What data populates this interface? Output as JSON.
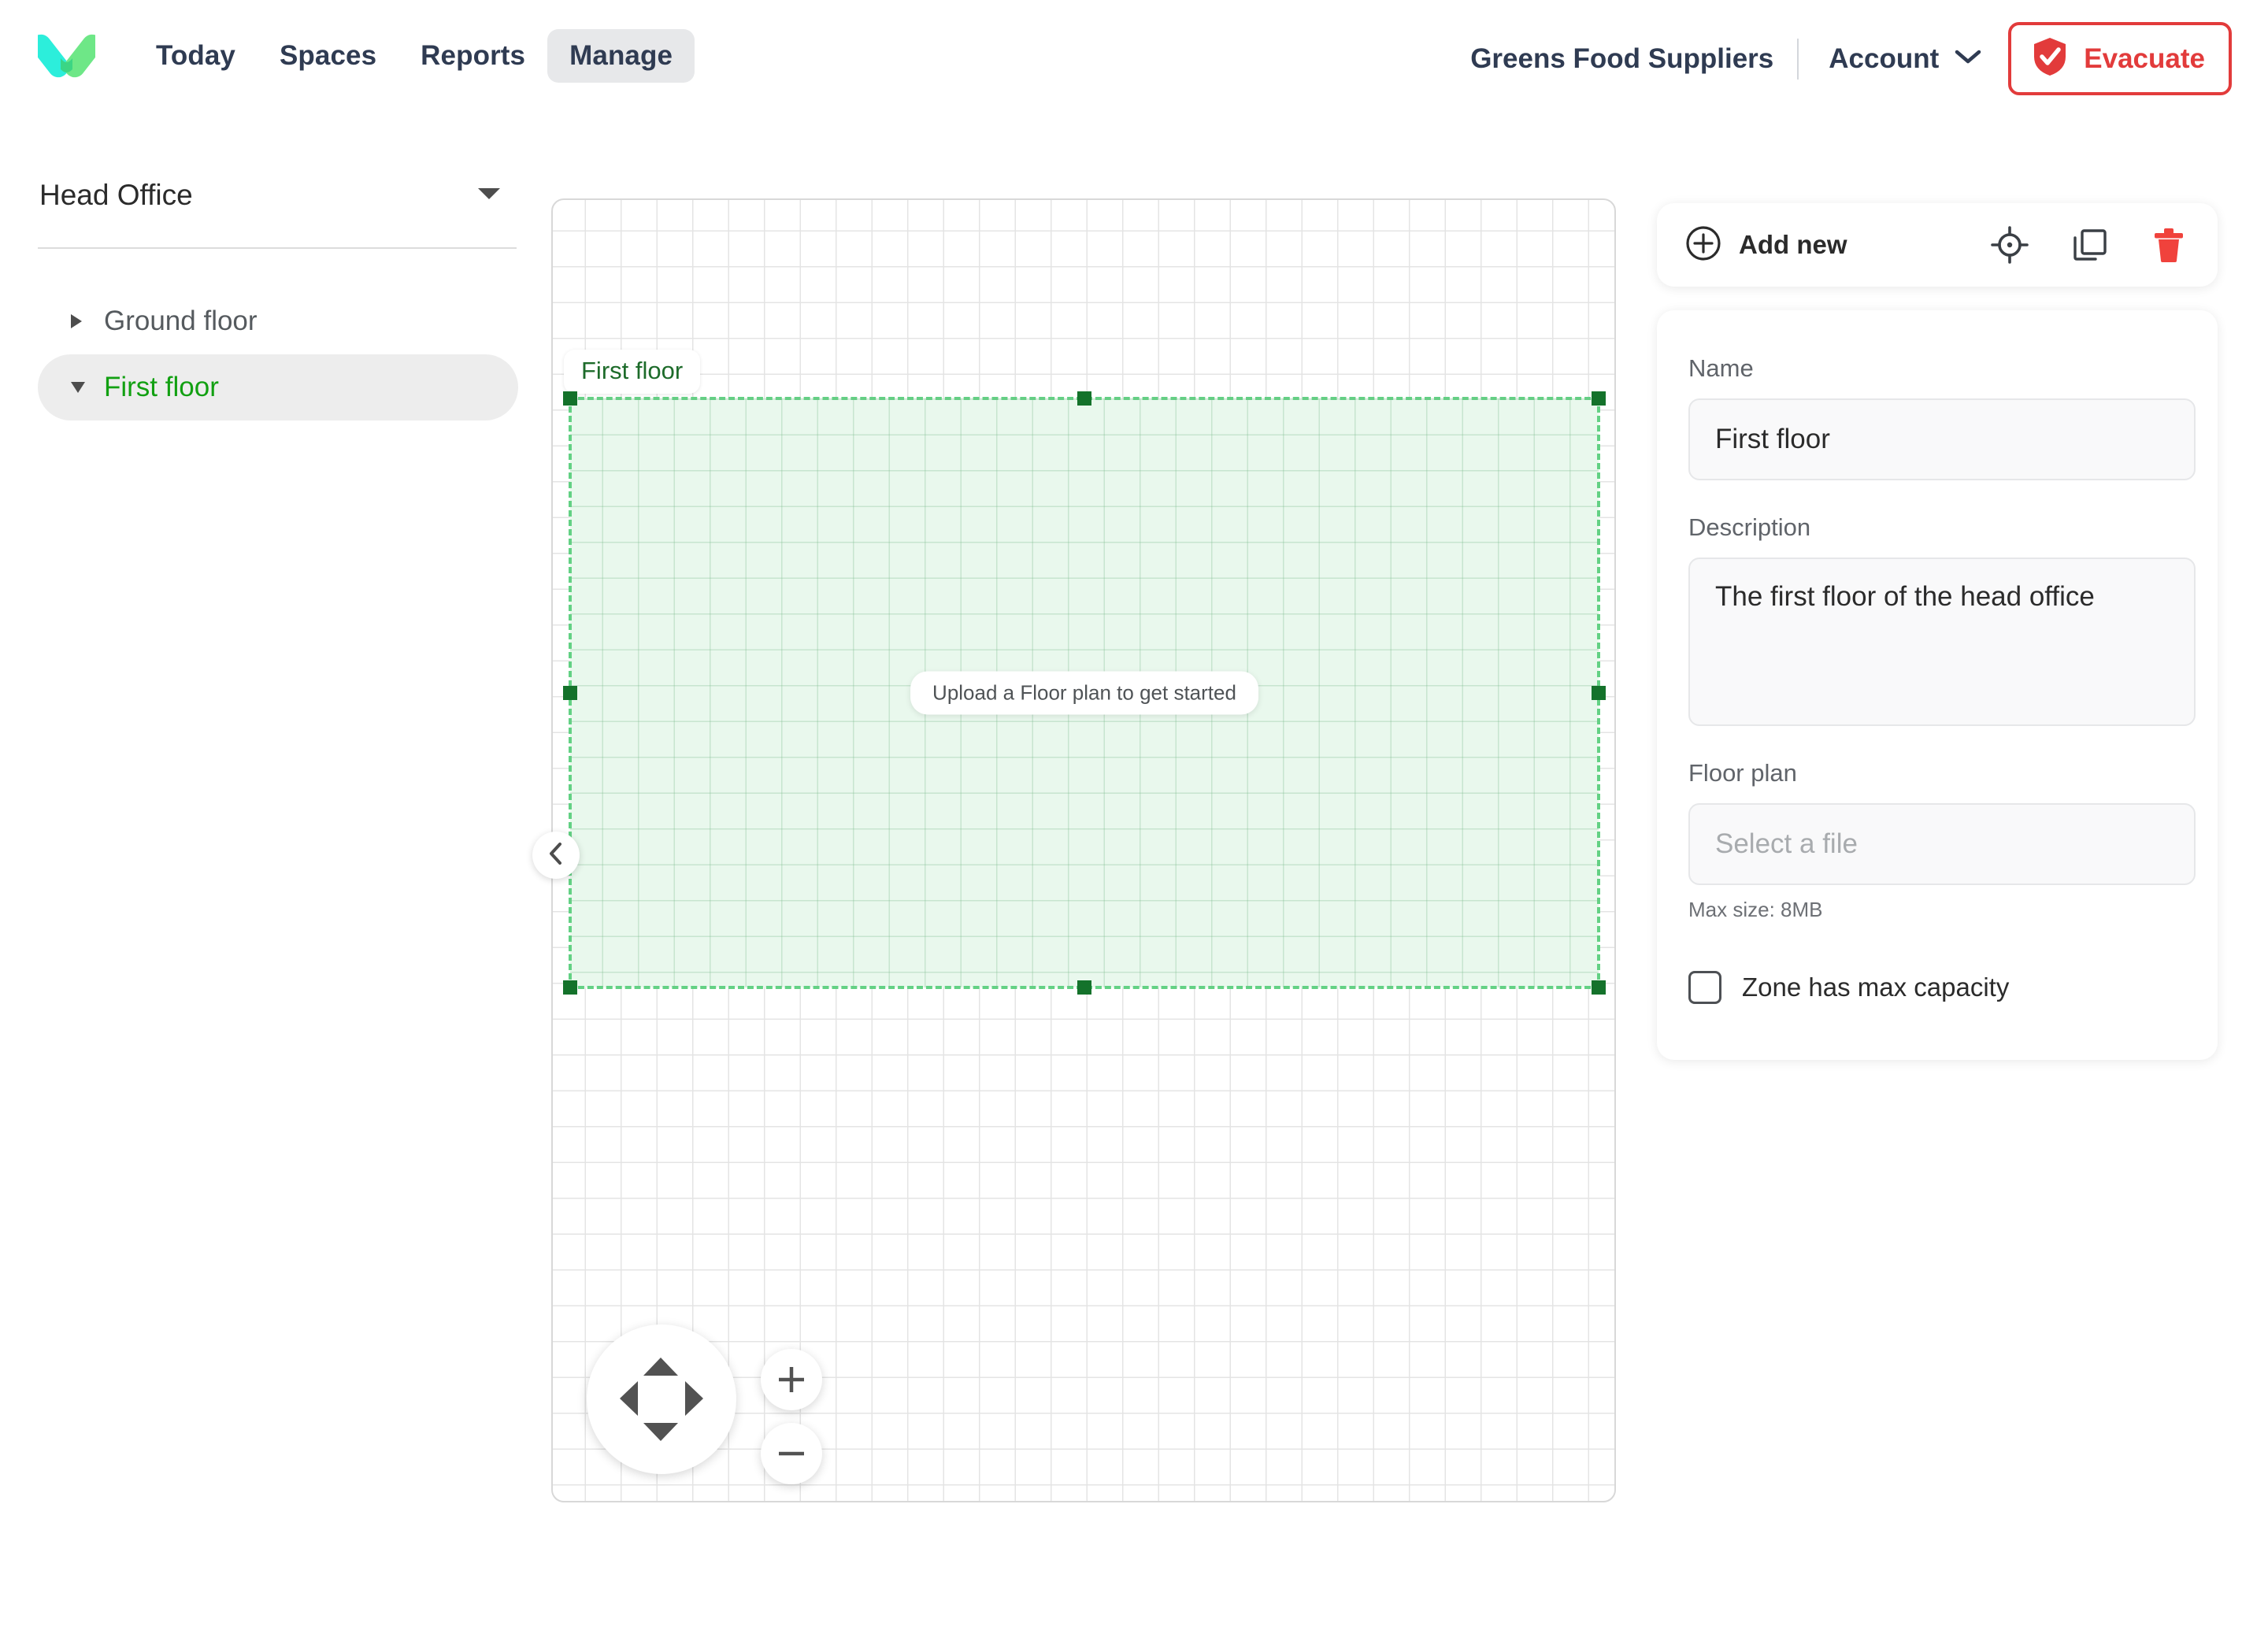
{
  "header": {
    "logo_icon": "v-checkmark-logo",
    "nav": [
      {
        "label": "Today",
        "active": false
      },
      {
        "label": "Spaces",
        "active": false
      },
      {
        "label": "Reports",
        "active": false
      },
      {
        "label": "Manage",
        "active": true
      }
    ],
    "org_name": "Greens Food Suppliers",
    "account_label": "Account",
    "account_caret_icon": "chevron-down-icon",
    "evacuate_label": "Evacuate",
    "evacuate_icon": "shield-check-icon",
    "evacuate_color": "#e23b3b"
  },
  "sidebar": {
    "site_name": "Head Office",
    "site_caret_icon": "caret-down-icon",
    "tree": [
      {
        "label": "Ground floor",
        "expanded": false,
        "selected": false,
        "caret_icon": "caret-right-icon"
      },
      {
        "label": "First floor",
        "expanded": true,
        "selected": true,
        "caret_icon": "caret-down-icon"
      }
    ],
    "selected_color": "#12a012"
  },
  "canvas": {
    "collapse_icon": "chevron-left-icon",
    "zone": {
      "label": "First floor",
      "placeholder_message": "Upload a Floor plan to get started",
      "fill_color": "#e9f8ed",
      "border_color": "#63d184",
      "handle_color": "#14722b",
      "label_text_color": "#1d6b2a"
    },
    "controls": {
      "pan_up_icon": "triangle-up-icon",
      "pan_down_icon": "triangle-down-icon",
      "pan_left_icon": "triangle-left-icon",
      "pan_right_icon": "triangle-right-icon",
      "zoom_in_label": "+",
      "zoom_out_label": "−"
    }
  },
  "panel": {
    "add_new_label": "Add new",
    "add_new_icon": "plus-circle-icon",
    "locate_icon": "crosshair-icon",
    "duplicate_icon": "copy-icon",
    "delete_icon": "trash-icon",
    "delete_color": "#f0423c",
    "name_label": "Name",
    "name_value": "First floor",
    "description_label": "Description",
    "description_value": "The first floor of the head office",
    "floorplan_label": "Floor plan",
    "floorplan_placeholder": "Select a file",
    "max_size_hint": "Max size: 8MB",
    "capacity_label": "Zone has max capacity",
    "capacity_checked": false
  }
}
